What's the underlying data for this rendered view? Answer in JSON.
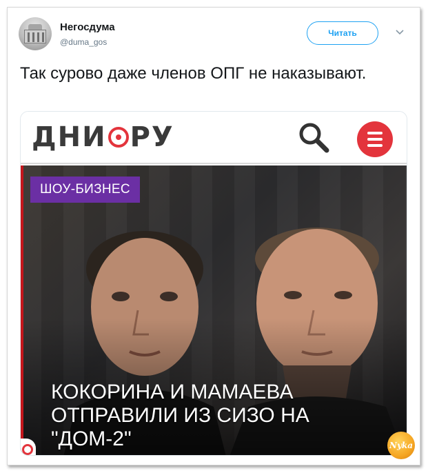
{
  "tweet": {
    "author_name": "Негосдума",
    "author_handle": "@duma_gos",
    "follow_label": "Читать",
    "text": "Так сурово даже членов ОПГ не наказывают."
  },
  "card": {
    "site_logo_before": "ДНИ",
    "site_logo_after": "РУ",
    "category": "ШОУ-БИЗНЕС",
    "headline": "КОКОРИНА И МАМАЕВА ОТПРАВИЛИ ИЗ СИЗО НА \"ДОМ-2\"",
    "icons": [
      "search-icon",
      "menu-icon"
    ]
  },
  "watermark_text": "Nyka",
  "colors": {
    "twitter_blue": "#1da1f2",
    "brand_red": "#e3343c",
    "category_purple": "#6b2fa4"
  }
}
